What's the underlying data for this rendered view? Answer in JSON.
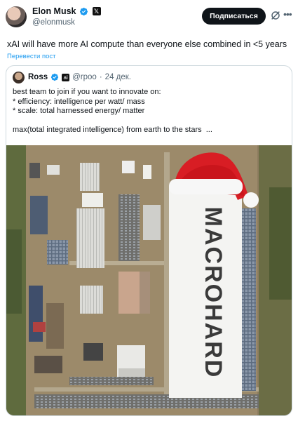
{
  "author": {
    "display_name": "Elon Musk",
    "handle": "@elonmusk",
    "avatar_icon": "profile-avatar",
    "verified_icon": "verified-badge-icon",
    "affiliate_badge": "𝕏"
  },
  "actions": {
    "subscribe_label": "Подписаться",
    "grok_icon": "grok-icon",
    "more_icon": "more-icon"
  },
  "tweet": {
    "text": "xAI will have more AI compute than everyone else combined in <5 years",
    "translate_label": "Перевести пост"
  },
  "quote": {
    "display_name": "Ross",
    "handle": "@rpoo",
    "separator": "·",
    "date": "24 дек.",
    "text": "best team to join if you want to innovate on:\n* efficiency: intelligence per watt/ mass\n* scale: total harnessed energy/ matter\n\nmax(total integrated intelligence) from earth to the stars  ...",
    "image": {
      "roof_text": "MACROHARD",
      "description_icon": "aerial-datacenter-photo-with-santa-hat"
    }
  },
  "colors": {
    "link": "#1d9bf0",
    "verified": "#1d9bf0",
    "border": "#cfd9de",
    "button_bg": "#0f1419"
  }
}
